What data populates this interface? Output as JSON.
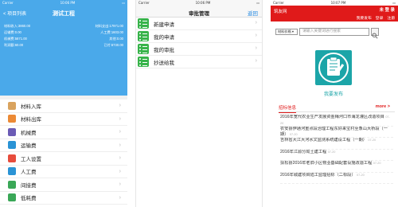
{
  "phone1": {
    "status": {
      "left": "Carrier",
      "center": "10:06 PM",
      "right": ""
    },
    "nav": {
      "back_label": "< 项目列表",
      "title": "测试工程"
    },
    "summary": [
      {
        "left": "材料收入:3860.00",
        "right": "材料支出:17971.00"
      },
      {
        "left": "运输费:0.00",
        "right": "人工费:1603.00"
      },
      {
        "left": "机械费:5871.00",
        "right": "其他:0.00"
      },
      {
        "left": "利润额:60.00",
        "right": "已付:6730.00"
      }
    ],
    "menu": [
      {
        "label": "材料入库",
        "icon": "warehouse-in-icon",
        "color": "#d9a35e"
      },
      {
        "label": "材料出库",
        "icon": "warehouse-out-icon",
        "color": "#ec8a35"
      },
      {
        "label": "机械费",
        "icon": "machine-icon",
        "color": "#6b5bb5"
      },
      {
        "label": "运输费",
        "icon": "truck-icon",
        "color": "#2a93d5"
      },
      {
        "label": "工人设置",
        "icon": "worker-icon",
        "color": "#e74c3c"
      },
      {
        "label": "人工费",
        "icon": "labor-icon",
        "color": "#2a93d5"
      },
      {
        "label": "间接费",
        "icon": "indirect-cost-icon",
        "color": "#3aa757"
      },
      {
        "label": "低耗费",
        "icon": "consumables-icon",
        "color": "#3aa757"
      }
    ]
  },
  "phone2": {
    "status": {
      "left": "Carrier",
      "center": "10:06 PM",
      "right": ""
    },
    "nav": {
      "title": "审批管理",
      "back_label": "返回"
    },
    "menu": [
      {
        "label": "新建申请",
        "icon": "new-request-icon"
      },
      {
        "label": "我的申请",
        "icon": "my-requests-icon"
      },
      {
        "label": "我的审批",
        "icon": "my-approvals-icon"
      },
      {
        "label": "抄送给我",
        "icon": "cc-to-me-icon"
      }
    ]
  },
  "phone3": {
    "status": {
      "left": "Carrier",
      "center": "10:07 PM",
      "right": ""
    },
    "header": {
      "brand": "筑友网",
      "login": "未 登 录",
      "links": [
        "我要发布",
        "登录",
        "注册"
      ]
    },
    "search": {
      "scope": "材料价格",
      "placeholder": "请输入关键词进行搜索"
    },
    "publish_label": "我要发布",
    "tabs": {
      "active": "招标信息",
      "more": "more >"
    },
    "news": [
      {
        "title": "2016年宽代农业生产发展资金梅河口市海龙灌区改造项目",
        "date": "07-20"
      },
      {
        "title": "农安县伊通河重点段治理工程东好来宝村至象山大桥段（一期）",
        "date": "07-20"
      },
      {
        "title": "吉林省大江大河水文监测系统建设工程（一期）",
        "date": "07-20"
      },
      {
        "title": "2016年江源分局土建工程",
        "date": "07-20"
      },
      {
        "title": "扶松县2016年老旧小区物业基础配套设施改造工程",
        "date": "07-20"
      },
      {
        "title": "2016年城建项目陆工监理招标（二标段）",
        "date": "07-20"
      }
    ]
  }
}
